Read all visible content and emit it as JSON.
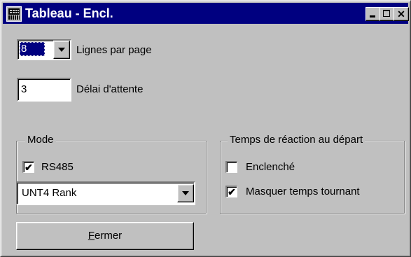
{
  "window": {
    "title": "Tableau - Encl."
  },
  "lines_per_page": {
    "value": "8",
    "label": "Lignes par page"
  },
  "timeout": {
    "value": "3",
    "label": "Délai d'attente"
  },
  "mode": {
    "title": "Mode",
    "rs485": {
      "label": "RS485",
      "checked": true
    },
    "protocol": {
      "selected": "UNT4 Rank"
    }
  },
  "reaction": {
    "title": "Temps de réaction au départ",
    "enabled": {
      "label": "Enclenché",
      "checked": false
    },
    "hide_rolling": {
      "label": "Masquer temps tournant",
      "checked": true
    }
  },
  "close_button": {
    "label_first": "F",
    "label_rest": "ermer"
  },
  "icons": {
    "title": "table-app-icon",
    "minimize": "minimize-icon",
    "maximize": "maximize-icon",
    "close": "close-icon",
    "dropdown": "chevron-down-icon",
    "check": "checkmark-icon"
  },
  "colors": {
    "titlebar": "#000080",
    "face": "#c0c0c0",
    "field": "#ffffff",
    "selection": "#000080"
  }
}
